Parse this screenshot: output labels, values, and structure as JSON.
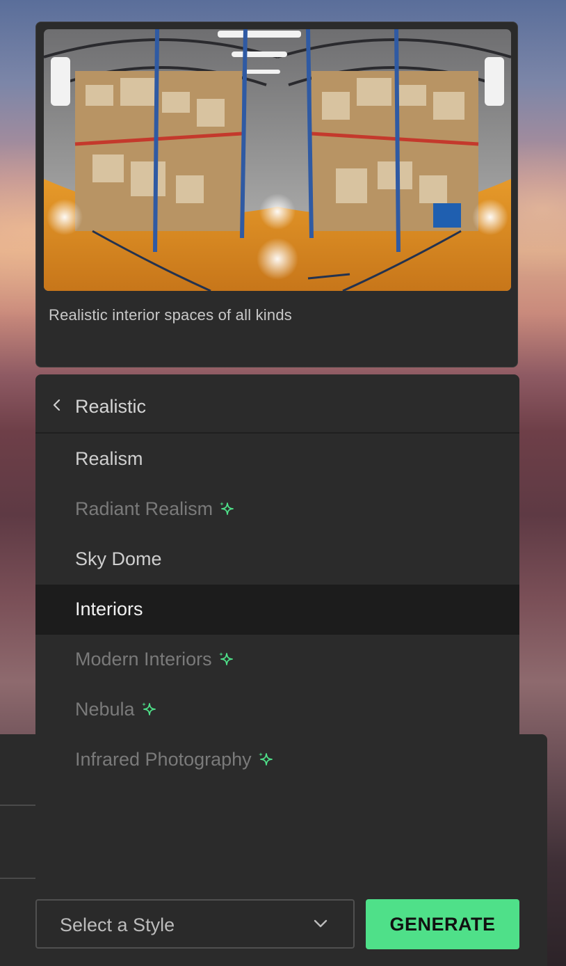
{
  "preview": {
    "caption": "Realistic interior spaces of all kinds",
    "image_subject": "panoramic warehouse interior with shelves of cardboard boxes and orange floor"
  },
  "menu": {
    "title": "Realistic",
    "items": [
      {
        "label": "Realism",
        "state": "available",
        "premium": false
      },
      {
        "label": "Radiant Realism",
        "state": "dimmed",
        "premium": true
      },
      {
        "label": "Sky Dome",
        "state": "available",
        "premium": false
      },
      {
        "label": "Interiors",
        "state": "selected",
        "premium": false
      },
      {
        "label": "Modern Interiors",
        "state": "dimmed",
        "premium": true
      },
      {
        "label": "Nebula",
        "state": "dimmed",
        "premium": true
      },
      {
        "label": "Infrared Photography",
        "state": "dimmed",
        "premium": true
      }
    ]
  },
  "footer": {
    "select_placeholder": "Select a Style",
    "generate_label": "GENERATE"
  },
  "icons": {
    "back": "chevron-left-icon",
    "premium": "sparkle-icon",
    "select": "chevron-down-icon"
  },
  "colors": {
    "accent": "#4fe089",
    "panel": "#2b2b2b",
    "selected_row": "#1c1c1c",
    "sparkle": "#4fe089"
  }
}
